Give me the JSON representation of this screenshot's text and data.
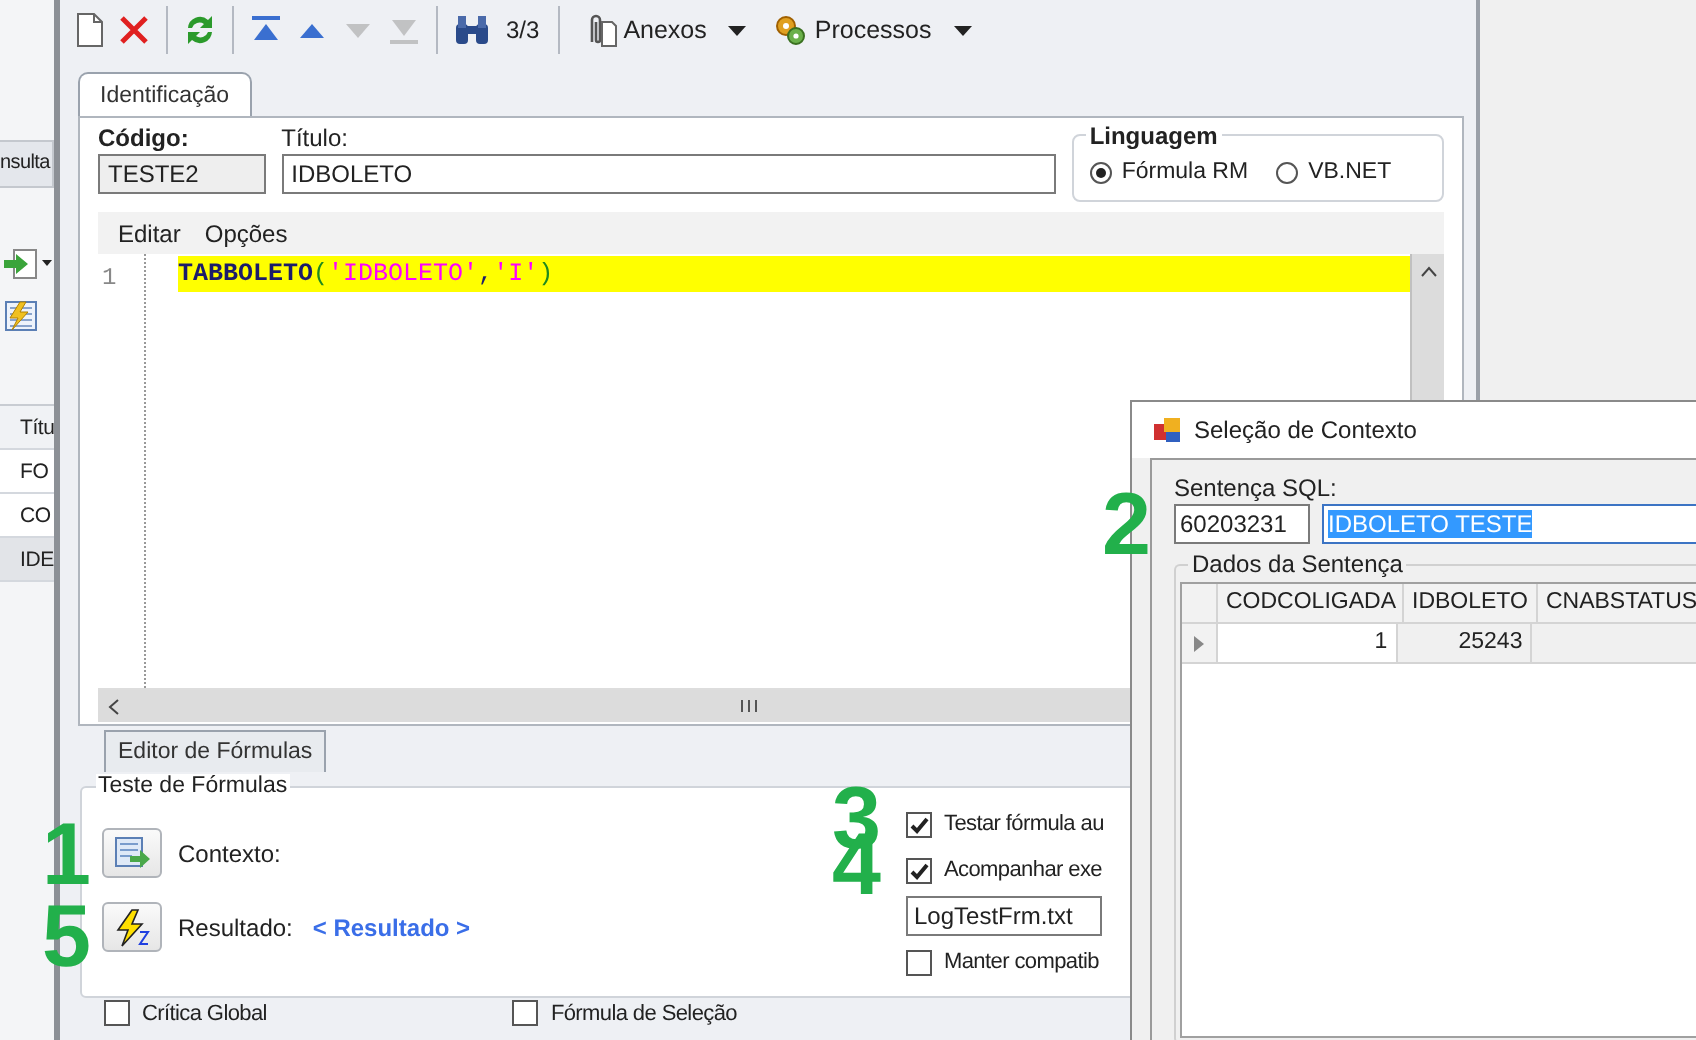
{
  "background_window": {
    "tab": "nsulta",
    "column_header": "Títu",
    "rows": [
      {
        "text": "FO",
        "selected": false
      },
      {
        "text": "CO",
        "selected": false
      },
      {
        "text": "IDE",
        "selected": true
      }
    ]
  },
  "toolbar": {
    "buttons": [
      {
        "kind": "new",
        "disabled": false
      },
      {
        "kind": "delete",
        "disabled": false
      },
      {
        "kind": "refresh",
        "disabled": false
      },
      {
        "kind": "first",
        "disabled": false
      },
      {
        "kind": "previous",
        "disabled": false
      },
      {
        "kind": "next",
        "disabled": true
      },
      {
        "kind": "last",
        "disabled": true
      }
    ],
    "counter": "3/3",
    "menus": [
      {
        "kind": "attachments",
        "label": "Anexos"
      },
      {
        "kind": "processes",
        "label": "Processos"
      }
    ]
  },
  "tabs": [
    {
      "label": "Identificação",
      "selected": true
    }
  ],
  "form": {
    "codigo": {
      "label": "Código:",
      "value": "TESTE2"
    },
    "titulo": {
      "label": "Título:",
      "value": "IDBOLETO"
    },
    "linguagem": {
      "title": "Linguagem",
      "options": [
        {
          "label": "Fórmula RM",
          "selected": true
        },
        {
          "label": "VB.NET",
          "selected": false
        }
      ]
    }
  },
  "editor": {
    "menu": [
      "Editar",
      "Opções"
    ],
    "lines": [
      {
        "number": "1",
        "highlighted": true,
        "tokens": [
          {
            "kind": "function",
            "text": "TABBOLETO"
          },
          {
            "kind": "paren",
            "text": "("
          },
          {
            "kind": "string",
            "text": "'IDBOLETO'"
          },
          {
            "kind": "punct",
            "text": ","
          },
          {
            "kind": "string",
            "text": "'I'"
          },
          {
            "kind": "paren",
            "text": ")"
          }
        ]
      }
    ]
  },
  "bottom_tabs": [
    {
      "label": "Editor de Fórmulas",
      "selected": true
    }
  ],
  "test_group": {
    "title": "Teste de Fórmulas",
    "context": {
      "marker": "1",
      "label": "Contexto:"
    },
    "result": {
      "marker": "5",
      "label": "Resultado:",
      "link": "< Resultado >"
    },
    "options": [
      {
        "kind": "checkbox",
        "marker": "3",
        "label": "Testar fórmula au",
        "checked": true
      },
      {
        "kind": "checkbox",
        "marker": "4",
        "label": "Acompanhar exe",
        "checked": true
      },
      {
        "kind": "field",
        "value": "LogTestFrm.txt"
      },
      {
        "kind": "checkbox",
        "label": "Manter compatib",
        "checked": false
      }
    ]
  },
  "footer_options": [
    {
      "label": "Crítica Global",
      "checked": false
    },
    {
      "label": "Fórmula de Seleção",
      "checked": false
    }
  ],
  "dialog": {
    "title": "Seleção de Contexto",
    "marker": "2",
    "sql_label": "Sentença SQL:",
    "sql_code": "60203231",
    "sql_name": "IDBOLETO TESTE",
    "grid_title": "Dados da Sentença",
    "columns": [
      "CODCOLIGADA",
      "IDBOLETO",
      "CNABSTATUS"
    ],
    "rows": [
      {
        "selected": true,
        "cells": [
          "1",
          "25243"
        ]
      }
    ]
  }
}
